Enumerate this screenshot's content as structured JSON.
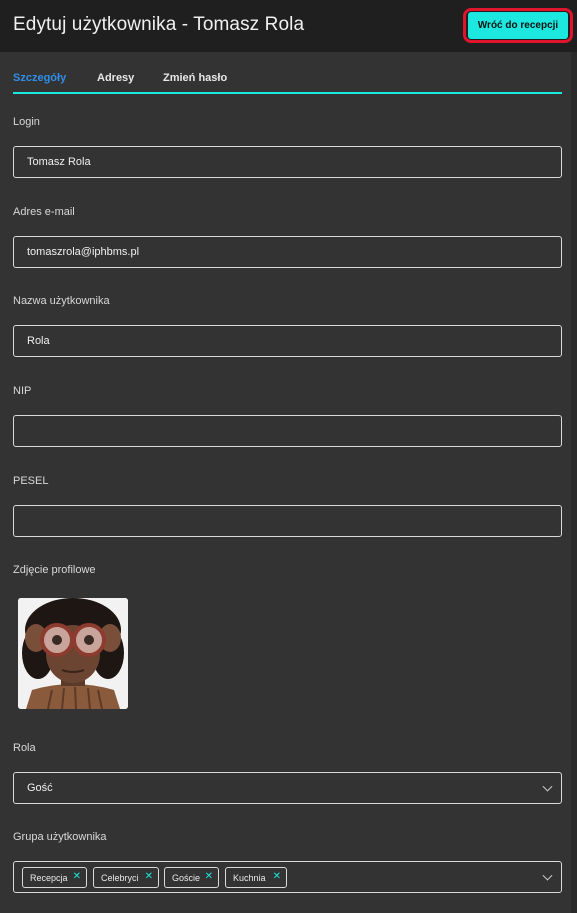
{
  "header": {
    "title": "Edytuj użytkownika - Tomasz Rola",
    "back_button": "Wróć do recepcji"
  },
  "tabs": [
    {
      "label": "Szczegóły",
      "active": true
    },
    {
      "label": "Adresy",
      "active": false
    },
    {
      "label": "Zmień hasło",
      "active": false
    }
  ],
  "form": {
    "login": {
      "label": "Login",
      "value": "Tomasz Rola"
    },
    "email": {
      "label": "Adres e-mail",
      "value": "tomaszrola@iphbms.pl"
    },
    "username": {
      "label": "Nazwa użytkownika",
      "value": "Rola"
    },
    "nip": {
      "label": "NIP",
      "value": ""
    },
    "pesel": {
      "label": "PESEL",
      "value": ""
    },
    "photo": {
      "label": "Zdjęcie profilowe"
    },
    "role": {
      "label": "Rola",
      "value": "Gość"
    },
    "group": {
      "label": "Grupa użytkownika",
      "tags": [
        "Recepcja",
        "Celebryci",
        "Goście",
        "Kuchnia"
      ]
    }
  },
  "colors": {
    "accent": "#1ce8e0",
    "active_tab": "#2f8fe8",
    "highlight_border": "#e0142c"
  }
}
